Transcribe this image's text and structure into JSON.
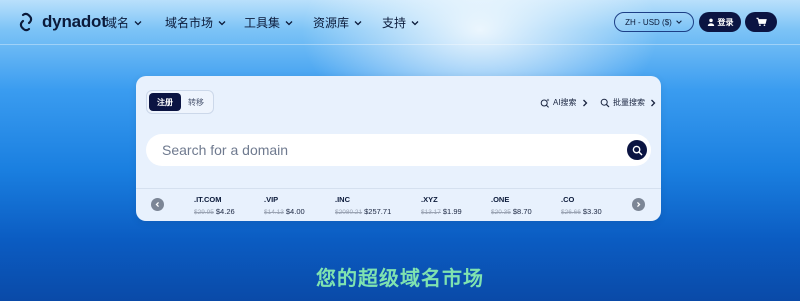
{
  "header": {
    "brand": "dynadot",
    "nav": [
      {
        "label": "域名"
      },
      {
        "label": "域名市场"
      },
      {
        "label": "工具集"
      },
      {
        "label": "资源库"
      },
      {
        "label": "支持"
      }
    ],
    "lang_currency": "ZH - USD ($)",
    "login_label": "登录"
  },
  "search_card": {
    "tabs": [
      {
        "label": "注册",
        "active": true
      },
      {
        "label": "转移",
        "active": false
      }
    ],
    "ai_search_label": "AI搜索",
    "bulk_search_label": "批量搜索",
    "search_placeholder": "Search for a domain",
    "tlds": [
      {
        "name": ".IT.COM",
        "old_price": "$29.95",
        "price": "$4.26"
      },
      {
        "name": ".VIP",
        "old_price": "$14.13",
        "price": "$4.00"
      },
      {
        "name": ".INC",
        "old_price": "$2080.21",
        "price": "$257.71"
      },
      {
        "name": ".XYZ",
        "old_price": "$13.17",
        "price": "$1.99"
      },
      {
        "name": ".ONE",
        "old_price": "$20.35",
        "price": "$8.70"
      },
      {
        "name": ".CO",
        "old_price": "$26.66",
        "price": "$3.30"
      }
    ]
  },
  "tagline": "您的超级域名市场",
  "colors": {
    "primary_dark": "#0b1442",
    "tagline_green": "#7fe3b0"
  }
}
